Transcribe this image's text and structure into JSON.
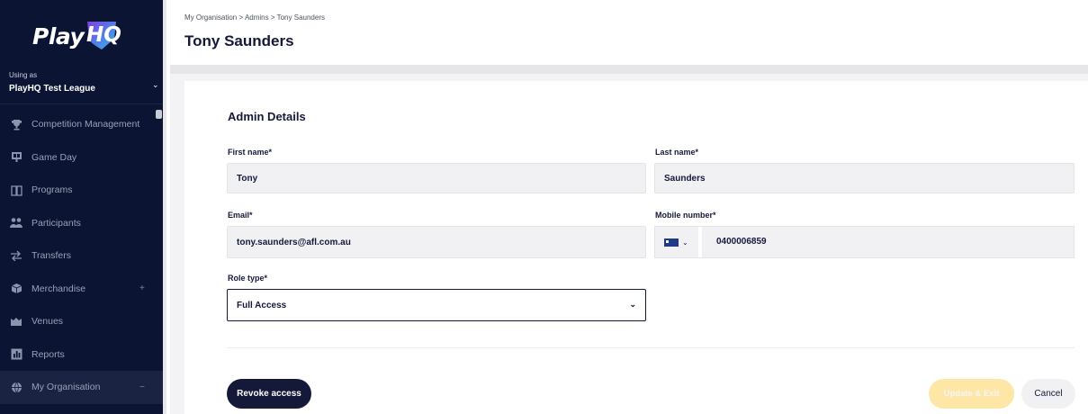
{
  "app": {
    "logo_play": "Play",
    "logo_hq": "HQ"
  },
  "sidebar": {
    "using_label": "Using as",
    "using_value": "PlayHQ Test League",
    "items": [
      {
        "label": "Competition Management",
        "icon": "trophy-icon"
      },
      {
        "label": "Game Day",
        "icon": "scoreboard-icon"
      },
      {
        "label": "Programs",
        "icon": "book-icon"
      },
      {
        "label": "Participants",
        "icon": "people-icon"
      },
      {
        "label": "Transfers",
        "icon": "transfer-icon"
      },
      {
        "label": "Merchandise",
        "icon": "box-icon",
        "trail": "+"
      },
      {
        "label": "Venues",
        "icon": "stadium-icon"
      },
      {
        "label": "Reports",
        "icon": "chart-icon"
      },
      {
        "label": "My Organisation",
        "icon": "globe-icon",
        "trail": "−",
        "active": true
      }
    ]
  },
  "header": {
    "breadcrumb": [
      "My Organisation",
      "Admins",
      "Tony Saunders"
    ],
    "breadcrumb_sep": ">",
    "title": "Tony Saunders"
  },
  "form": {
    "section_title": "Admin Details",
    "first_name_label": "First name*",
    "first_name_value": "Tony",
    "last_name_label": "Last name*",
    "last_name_value": "Saunders",
    "email_label": "Email*",
    "email_value": "tony.saunders@afl.com.au",
    "mobile_label": "Mobile number*",
    "mobile_value": "0400006859",
    "role_label": "Role type*",
    "role_value": "Full Access"
  },
  "actions": {
    "revoke_label": "Revoke access",
    "update_label": "Update & Exit",
    "cancel_label": "Cancel"
  },
  "colors": {
    "sidebar_bg": "#0b1433",
    "brand_navy": "#14193a",
    "accent_yellow": "#fde6a6",
    "shield_gradient_start": "#7b3fe4",
    "shield_gradient_end": "#2fb7e8"
  }
}
